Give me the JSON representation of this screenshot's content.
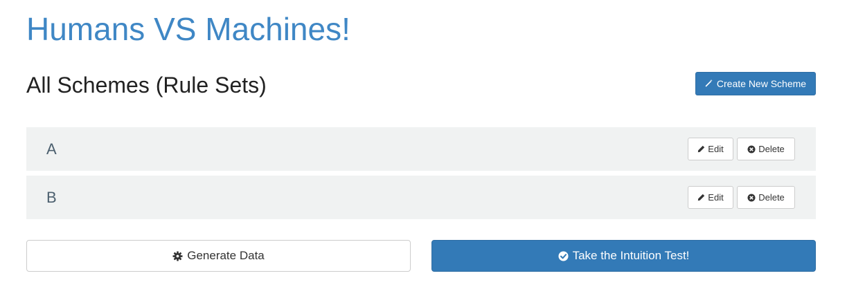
{
  "app": {
    "title": "Humans VS Machines!"
  },
  "schemes_section": {
    "title": "All Schemes (Rule Sets)",
    "create_label": "Create New Scheme",
    "create_icon": "magic-wand-icon"
  },
  "schemes": [
    {
      "name": "A",
      "edit_label": "Edit",
      "delete_label": "Delete"
    },
    {
      "name": "B",
      "edit_label": "Edit",
      "delete_label": "Delete"
    }
  ],
  "actions": {
    "generate_label": "Generate Data",
    "generate_icon": "gear-icon",
    "intuition_label": "Take the Intuition Test!",
    "intuition_icon": "check-circle-icon"
  },
  "colors": {
    "primary": "#337ab7",
    "title": "#3f87c5",
    "row_bg": "#f0f2f2"
  }
}
